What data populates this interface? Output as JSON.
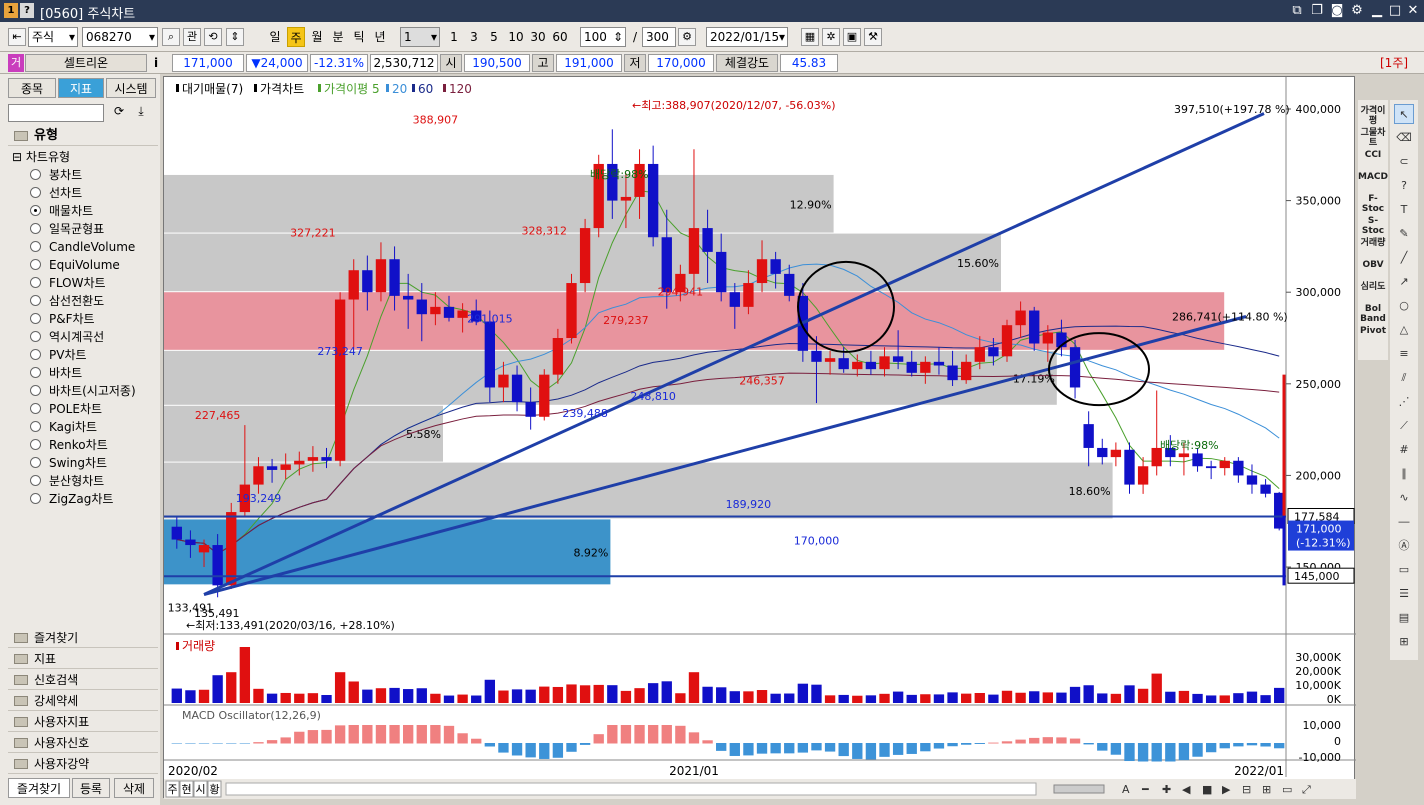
{
  "window": {
    "badge1": "1",
    "badge2": "?",
    "title": "[0560] 주식차트"
  },
  "toolbar": {
    "market": "주식",
    "code": "068270",
    "btn_gwan": "관",
    "periods": [
      "일",
      "주",
      "월",
      "분",
      "틱",
      "년"
    ],
    "count_select": "1",
    "nums": [
      "1",
      "3",
      "5",
      "10",
      "30",
      "60"
    ],
    "view_count": "100",
    "slash": "/",
    "total": "300",
    "date": "2022/01/15"
  },
  "pricebar": {
    "tag": "거",
    "name": "셀트리온",
    "info_icon": "i",
    "price": "171,000",
    "change": "▼24,000",
    "rate": "-12.31%",
    "volume": "2,530,712",
    "open_label": "시",
    "open": "190,500",
    "high_label": "고",
    "high": "191,000",
    "low_label": "저",
    "low": "170,000",
    "strength_label": "체결강도",
    "strength": "45.83",
    "unit": "[1주]"
  },
  "left": {
    "tabs": [
      "종목",
      "지표",
      "시스템"
    ],
    "section": "유형",
    "subsection": "차트유형",
    "chart_types": [
      "봉차트",
      "선차트",
      "매물차트",
      "일목균형표",
      "CandleVolume",
      "EquiVolume",
      "FLOW차트",
      "삼선전환도",
      "P&F차트",
      "역시계곡선",
      "PV차트",
      "바차트",
      "바차트(시고저종)",
      "POLE차트",
      "Kagi차트",
      "Renko차트",
      "Swing차트",
      "분산형차트",
      "ZigZag차트"
    ],
    "selected_index": 2,
    "folders": [
      "즐겨찾기",
      "지표",
      "신호검색",
      "강세약세",
      "사용자지표",
      "사용자신호",
      "사용자강약"
    ],
    "bottom_tabs": [
      "즐겨찾기",
      "등록",
      "삭제"
    ]
  },
  "right_tools": [
    "가격이평",
    "그물차트",
    "CCI",
    "MACD",
    "F-Stoc",
    "S-Stoc",
    "거래량",
    "OBV",
    "심리도",
    "Bol Band",
    "Pivot"
  ],
  "bottom": {
    "tabs": [
      "주",
      "현",
      "시",
      "황"
    ],
    "x_labels": [
      "2020/02",
      "2021/01",
      "2022/01"
    ]
  },
  "chart_data": {
    "type": "candlestick",
    "legend": [
      "대기매물(7)",
      "가격차트",
      "가격이평 5",
      "20",
      "60",
      "120"
    ],
    "y_ticks": [
      "400,000",
      "350,000",
      "300,000",
      "250,000",
      "200,000",
      "150,000"
    ],
    "ylim": [
      120000,
      412000
    ],
    "annotations": {
      "high_note": "←최고:388,907(2020/12/07, -56.03%)",
      "low_note": "←최저:133,491(2020/03/16, +28.10%)",
      "trend_top": "397,510(+197.78 %)",
      "trend_mid": "286,741(+114.80 %)",
      "dividend1": "배당락:98%",
      "dividend2": "배당락:98%",
      "overlap_low": "135,491",
      "current_line": "177,584",
      "current_price": "171,000",
      "current_rate": "(-12.31%)",
      "support_line": "145,000"
    },
    "price_labels": [
      {
        "text": "388,907",
        "i": 19,
        "v": 388907,
        "c": "red"
      },
      {
        "text": "327,221",
        "i": 10,
        "v": 327221,
        "c": "red"
      },
      {
        "text": "227,465",
        "i": 3,
        "v": 227465,
        "c": "red"
      },
      {
        "text": "328,312",
        "i": 27,
        "v": 328312,
        "c": "red"
      },
      {
        "text": "294,941",
        "i": 37,
        "v": 294941,
        "c": "red"
      },
      {
        "text": "279,237",
        "i": 33,
        "v": 279237,
        "c": "red"
      },
      {
        "text": "246,357",
        "i": 43,
        "v": 246357,
        "c": "red"
      },
      {
        "text": "273,247",
        "i": 12,
        "v": 273247,
        "c": "blue"
      },
      {
        "text": "193,249",
        "i": 6,
        "v": 193249,
        "c": "blue"
      },
      {
        "text": "291,015",
        "i": 23,
        "v": 291015,
        "c": "blue"
      },
      {
        "text": "239,488",
        "i": 30,
        "v": 239488,
        "c": "blue"
      },
      {
        "text": "248,810",
        "i": 35,
        "v": 248810,
        "c": "blue"
      },
      {
        "text": "189,920",
        "i": 42,
        "v": 189920,
        "c": "blue"
      },
      {
        "text": "170,000",
        "i": 47,
        "v": 170000,
        "c": "blue"
      },
      {
        "text": "133,491",
        "i": 1,
        "v": 133491,
        "c": "black"
      }
    ],
    "volume_profile": [
      {
        "lo": 140000,
        "hi": 176000,
        "pct": "8.92%",
        "pos": 0.4,
        "blue": true
      },
      {
        "lo": 176000,
        "hi": 207000,
        "pct": "18.60%",
        "pos": 0.85
      },
      {
        "lo": 238000,
        "hi": 268000,
        "pct": "17.19%",
        "pos": 0.8
      },
      {
        "lo": 207000,
        "hi": 238000,
        "pct": "5.58%",
        "pos": 0.25
      },
      {
        "lo": 268000,
        "hi": 300000,
        "pct": "",
        "pos": 0.95,
        "pink": true
      },
      {
        "lo": 300000,
        "hi": 332000,
        "pct": "15.60%",
        "pos": 0.75
      },
      {
        "lo": 332000,
        "hi": 364000,
        "pct": "12.90%",
        "pos": 0.6
      }
    ],
    "candles": [
      [
        172000,
        178000,
        160000,
        165000
      ],
      [
        165000,
        170000,
        155000,
        162000
      ],
      [
        158000,
        165000,
        150000,
        162000
      ],
      [
        162000,
        168000,
        133491,
        140000
      ],
      [
        140000,
        185000,
        138000,
        180000
      ],
      [
        180000,
        227465,
        178000,
        195000
      ],
      [
        195000,
        210000,
        190000,
        205000
      ],
      [
        205000,
        209000,
        196000,
        203000
      ],
      [
        203000,
        212000,
        198000,
        206000
      ],
      [
        206000,
        213000,
        200000,
        208000
      ],
      [
        208000,
        216000,
        202000,
        210000
      ],
      [
        210000,
        215000,
        204000,
        208000
      ],
      [
        208000,
        300000,
        205000,
        296000
      ],
      [
        296000,
        318000,
        270000,
        312000
      ],
      [
        312000,
        320000,
        290000,
        300000
      ],
      [
        300000,
        327221,
        295000,
        318000
      ],
      [
        318000,
        325000,
        290000,
        298000
      ],
      [
        298000,
        310000,
        280000,
        296000
      ],
      [
        296000,
        305000,
        273247,
        288000
      ],
      [
        288000,
        300000,
        282000,
        292000
      ],
      [
        292000,
        298000,
        284000,
        286000
      ],
      [
        286000,
        294000,
        278000,
        290000
      ],
      [
        290000,
        296000,
        282000,
        284000
      ],
      [
        284000,
        290000,
        240000,
        248000
      ],
      [
        248000,
        262000,
        240000,
        255000
      ],
      [
        255000,
        260000,
        235000,
        240000
      ],
      [
        240000,
        248000,
        225000,
        232000
      ],
      [
        232000,
        258000,
        230000,
        255000
      ],
      [
        255000,
        280000,
        250000,
        275000
      ],
      [
        275000,
        310000,
        272000,
        305000
      ],
      [
        305000,
        340000,
        300000,
        335000
      ],
      [
        335000,
        375000,
        330000,
        370000
      ],
      [
        370000,
        388907,
        340000,
        350000
      ],
      [
        350000,
        365000,
        335000,
        352000
      ],
      [
        352000,
        378000,
        340000,
        370000
      ],
      [
        370000,
        380000,
        325000,
        330000
      ],
      [
        330000,
        345000,
        291015,
        300000
      ],
      [
        300000,
        315000,
        295000,
        310000
      ],
      [
        310000,
        378000,
        302000,
        335000
      ],
      [
        335000,
        345000,
        305000,
        322000
      ],
      [
        322000,
        332000,
        295000,
        300000
      ],
      [
        300000,
        305000,
        280000,
        292000
      ],
      [
        292000,
        312000,
        288000,
        305000
      ],
      [
        305000,
        328312,
        300000,
        318000
      ],
      [
        318000,
        322000,
        302000,
        310000
      ],
      [
        310000,
        315000,
        295000,
        298000
      ],
      [
        298000,
        305000,
        262000,
        268000
      ],
      [
        268000,
        276000,
        239488,
        262000
      ],
      [
        262000,
        268000,
        255000,
        264000
      ],
      [
        264000,
        270000,
        256000,
        258000
      ],
      [
        258000,
        266000,
        254000,
        262000
      ],
      [
        262000,
        268000,
        255000,
        258000
      ],
      [
        258000,
        270000,
        254000,
        265000
      ],
      [
        265000,
        279237,
        258000,
        262000
      ],
      [
        262000,
        268000,
        254000,
        256000
      ],
      [
        256000,
        265000,
        250000,
        262000
      ],
      [
        262000,
        270000,
        255000,
        260000
      ],
      [
        260000,
        268000,
        248810,
        252000
      ],
      [
        252000,
        266000,
        250000,
        262000
      ],
      [
        262000,
        276000,
        258000,
        270000
      ],
      [
        270000,
        275000,
        260000,
        265000
      ],
      [
        265000,
        285000,
        262000,
        282000
      ],
      [
        282000,
        294941,
        275000,
        290000
      ],
      [
        290000,
        292000,
        268000,
        272000
      ],
      [
        272000,
        282000,
        262000,
        278000
      ],
      [
        278000,
        285000,
        265000,
        270000
      ],
      [
        270000,
        274000,
        242000,
        248000
      ],
      [
        228000,
        235000,
        205000,
        215000
      ],
      [
        215000,
        220000,
        206000,
        210000
      ],
      [
        210000,
        218000,
        205000,
        214000
      ],
      [
        214000,
        218000,
        190000,
        195000
      ],
      [
        195000,
        210000,
        189920,
        205000
      ],
      [
        205000,
        246357,
        200000,
        215000
      ],
      [
        215000,
        222000,
        205000,
        210000
      ],
      [
        210000,
        218000,
        200000,
        212000
      ],
      [
        212000,
        215000,
        202000,
        205000
      ],
      [
        205000,
        208000,
        198000,
        204000
      ],
      [
        204000,
        210000,
        200000,
        208000
      ],
      [
        208000,
        210000,
        196000,
        200000
      ],
      [
        200000,
        206000,
        190000,
        195000
      ],
      [
        195000,
        198000,
        188000,
        190000
      ],
      [
        190500,
        191000,
        170000,
        171000
      ]
    ],
    "volume": {
      "label": "거래량",
      "ticks": [
        "30,000K",
        "20,000K",
        "10,000K",
        "0K"
      ]
    },
    "macd": {
      "label": "MACD Oscillator(12,26,9)",
      "ticks": [
        "10,000",
        "0",
        "-10,000"
      ]
    }
  }
}
